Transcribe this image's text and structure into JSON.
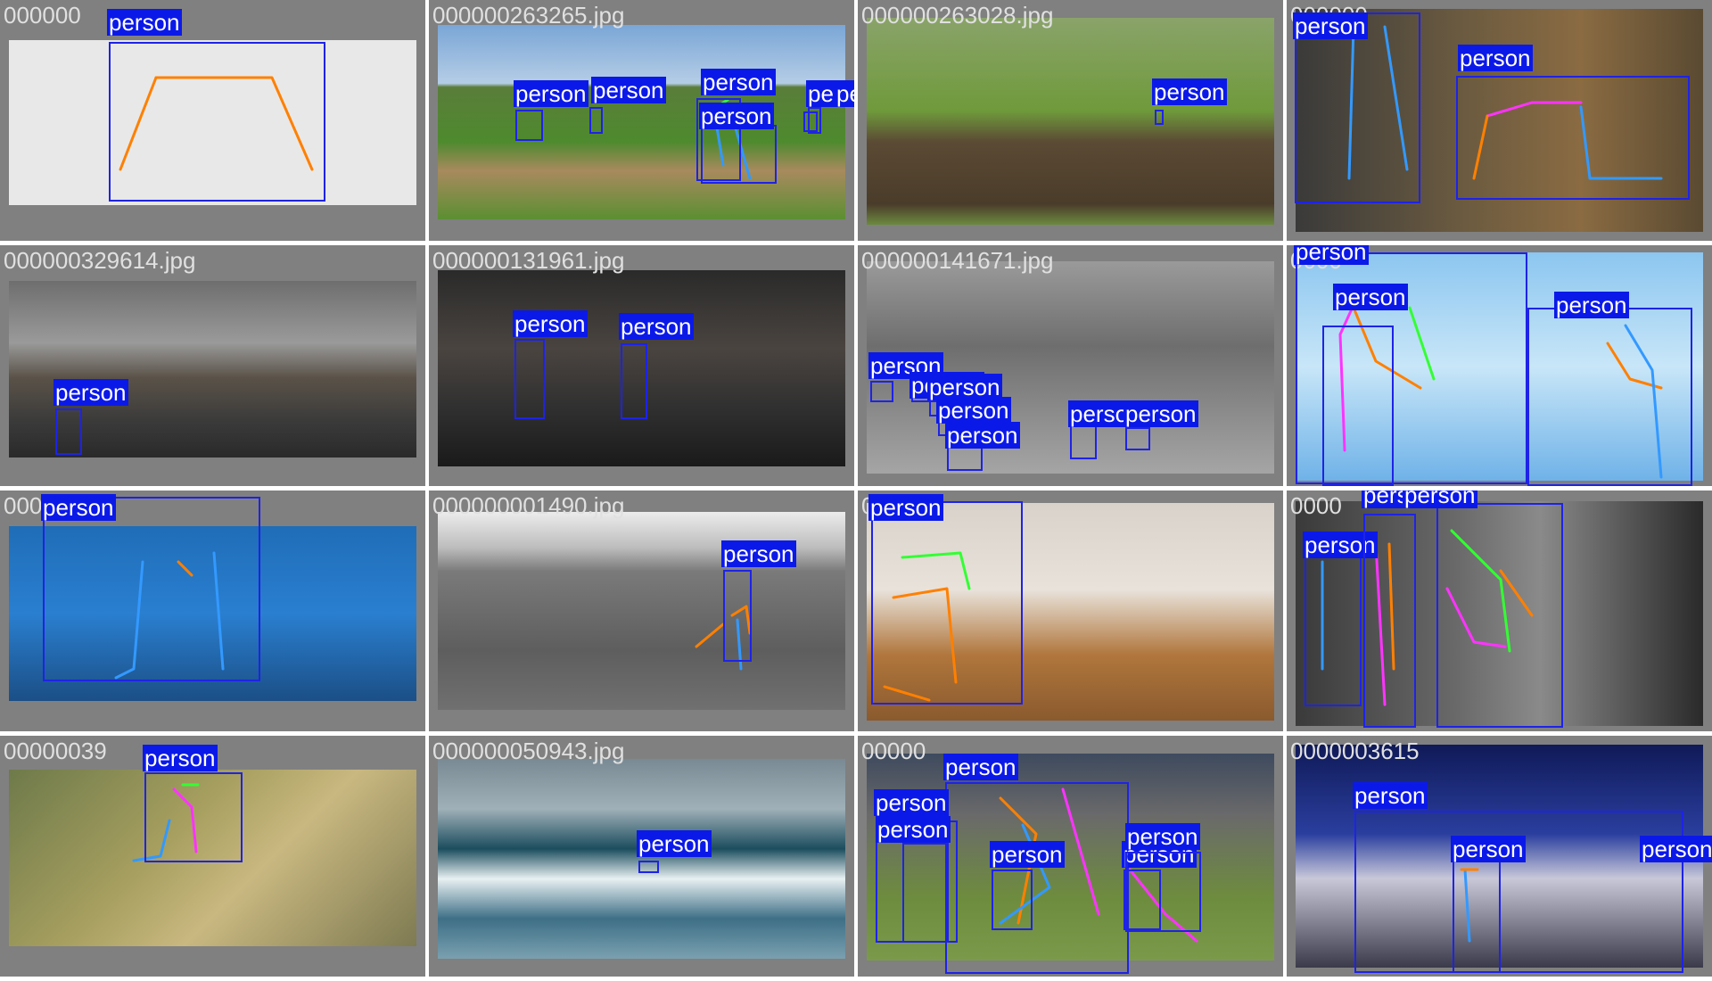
{
  "label_text": "person",
  "colors": {
    "box": "#1e23e6",
    "label_bg": "#0b19e8",
    "limb_orange": "#ff8000",
    "limb_blue": "#3399ff",
    "limb_pink": "#ff33ff",
    "limb_green": "#33ff33",
    "tile_bg": "#808080"
  },
  "tiles": [
    {
      "filename": "000000",
      "filename_tail": ".jpg"
    },
    {
      "filename": "000000263265.jpg"
    },
    {
      "filename": "000000263028.jpg"
    },
    {
      "filename": "000000",
      "filename_tail": "999.jpg"
    },
    {
      "filename": "000000329614.jpg"
    },
    {
      "filename": "000000131961.jpg"
    },
    {
      "filename": "000000141671.jpg"
    },
    {
      "filename": "0000",
      "filename_tail": "3.jpg"
    },
    {
      "filename": "000",
      "filename_tail": "2336.jpg"
    },
    {
      "filename": "000000001490.jpg"
    },
    {
      "filename": "0",
      "filename_tail": "525898.jpg"
    },
    {
      "filename": "0000",
      "filename_tail": "78.jpg"
    },
    {
      "filename": "00000039",
      "filename_tail": ""
    },
    {
      "filename": "000000050943.jpg"
    },
    {
      "filename": "00000",
      "filename_tail": ".jpg"
    },
    {
      "filename": "0000003615",
      "filename_tail": ".jpg"
    }
  ]
}
